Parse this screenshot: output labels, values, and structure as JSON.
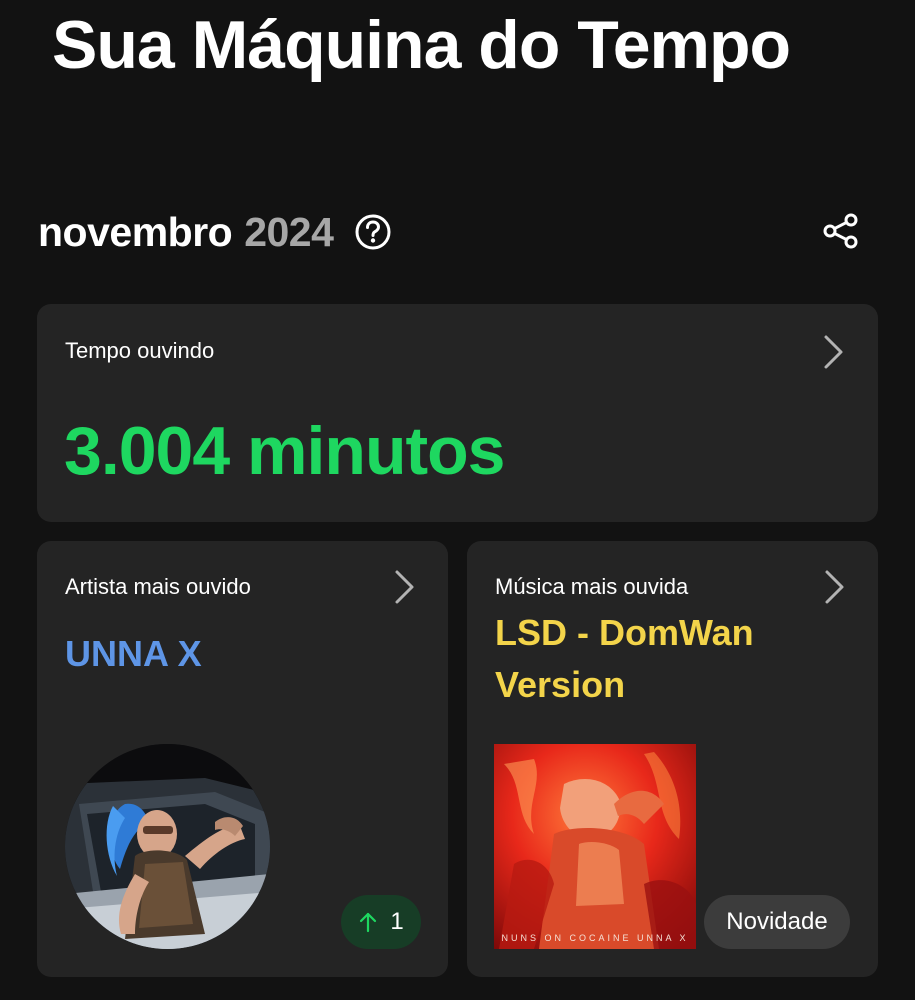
{
  "header": {
    "title": "Sua Máquina do Tempo"
  },
  "period": {
    "month": "novembro",
    "year": "2024",
    "help_icon": "help-circle-icon",
    "share_icon": "share-icon"
  },
  "time_card": {
    "label": "Tempo ouvindo",
    "value": "3.004 minutos",
    "accent_color": "#1ed760",
    "chevron_icon": "chevron-right-icon"
  },
  "artist_card": {
    "label": "Artista mais ouvido",
    "name": "UNNA X",
    "name_color": "#5e95e6",
    "chevron_icon": "chevron-right-icon",
    "rank_icon": "arrow-up-icon",
    "rank_value": "1"
  },
  "track_card": {
    "label": "Música mais ouvida",
    "title": "LSD - DomWan Version",
    "title_color": "#f3d44a",
    "chevron_icon": "chevron-right-icon",
    "album_text": "NUNS ON COCAINE UNNA X",
    "badge": "Novidade"
  },
  "colors": {
    "background": "#121212",
    "card": "#242424",
    "muted_text": "#a7a7a7"
  }
}
